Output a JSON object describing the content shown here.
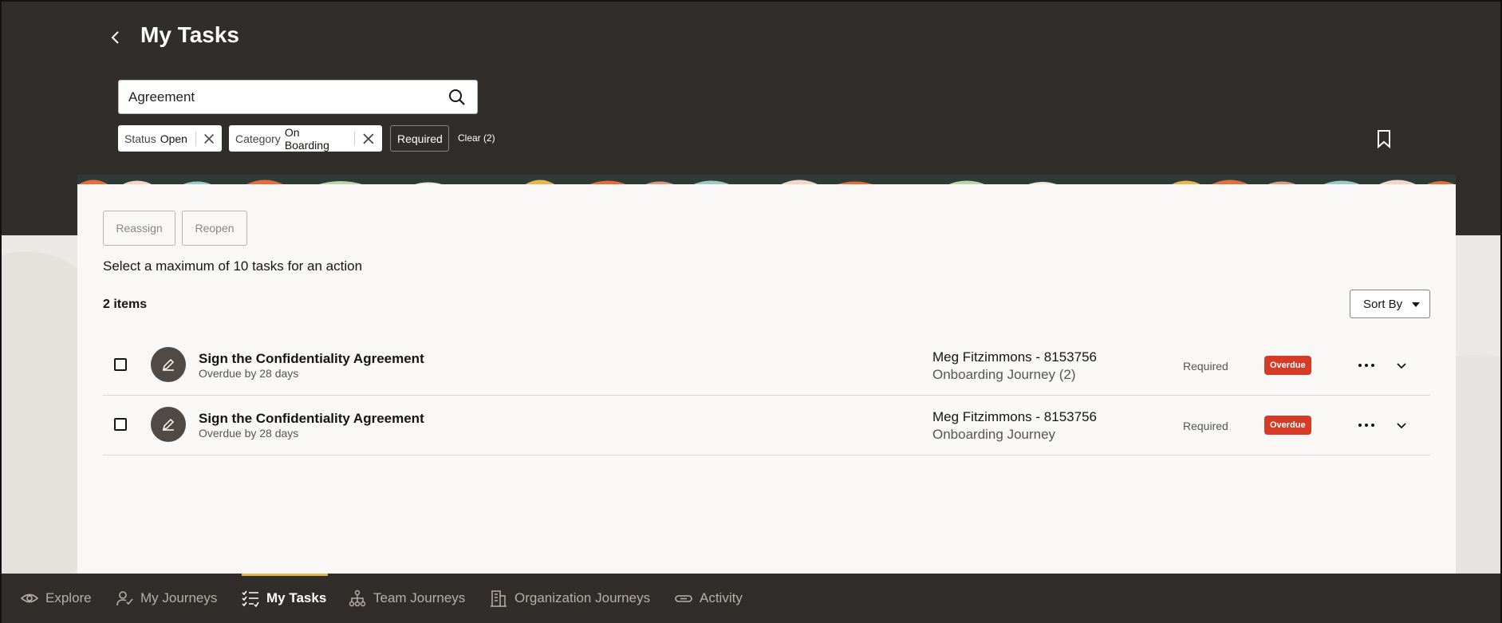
{
  "header": {
    "title": "My Tasks",
    "search": {
      "value": "Agreement",
      "placeholder": ""
    },
    "filters": [
      {
        "label": "Status",
        "value": "Open"
      },
      {
        "label": "Category",
        "value": "On Boarding"
      }
    ],
    "required_chip": "Required",
    "clear_link": "Clear (2)"
  },
  "toolbar": {
    "reassign_label": "Reassign",
    "reopen_label": "Reopen",
    "hint": "Select a maximum of 10 tasks for an action",
    "count": "2 items",
    "sort_label": "Sort By"
  },
  "tasks": [
    {
      "title": "Sign the Confidentiality Agreement",
      "subtitle": "Overdue by 28 days",
      "person": "Meg Fitzimmons - 8153756",
      "journey": "Onboarding Journey (2)",
      "requirement": "Required",
      "status": "Overdue"
    },
    {
      "title": "Sign the Confidentiality Agreement",
      "subtitle": "Overdue by 28 days",
      "person": "Meg Fitzimmons - 8153756",
      "journey": "Onboarding Journey",
      "requirement": "Required",
      "status": "Overdue"
    }
  ],
  "nav": {
    "items": [
      {
        "label": "Explore",
        "icon": "eye-icon"
      },
      {
        "label": "My Journeys",
        "icon": "person-check-icon"
      },
      {
        "label": "My Tasks",
        "icon": "checklist-icon",
        "active": true
      },
      {
        "label": "Team Journeys",
        "icon": "org-chart-icon"
      },
      {
        "label": "Organization Journeys",
        "icon": "building-icon"
      },
      {
        "label": "Activity",
        "icon": "link-icon"
      }
    ]
  },
  "colors": {
    "header_bg": "#312d2a",
    "card_bg": "#f9f8f6",
    "overdue": "#d63b25",
    "nav_active_bar": "#e2b44c"
  }
}
